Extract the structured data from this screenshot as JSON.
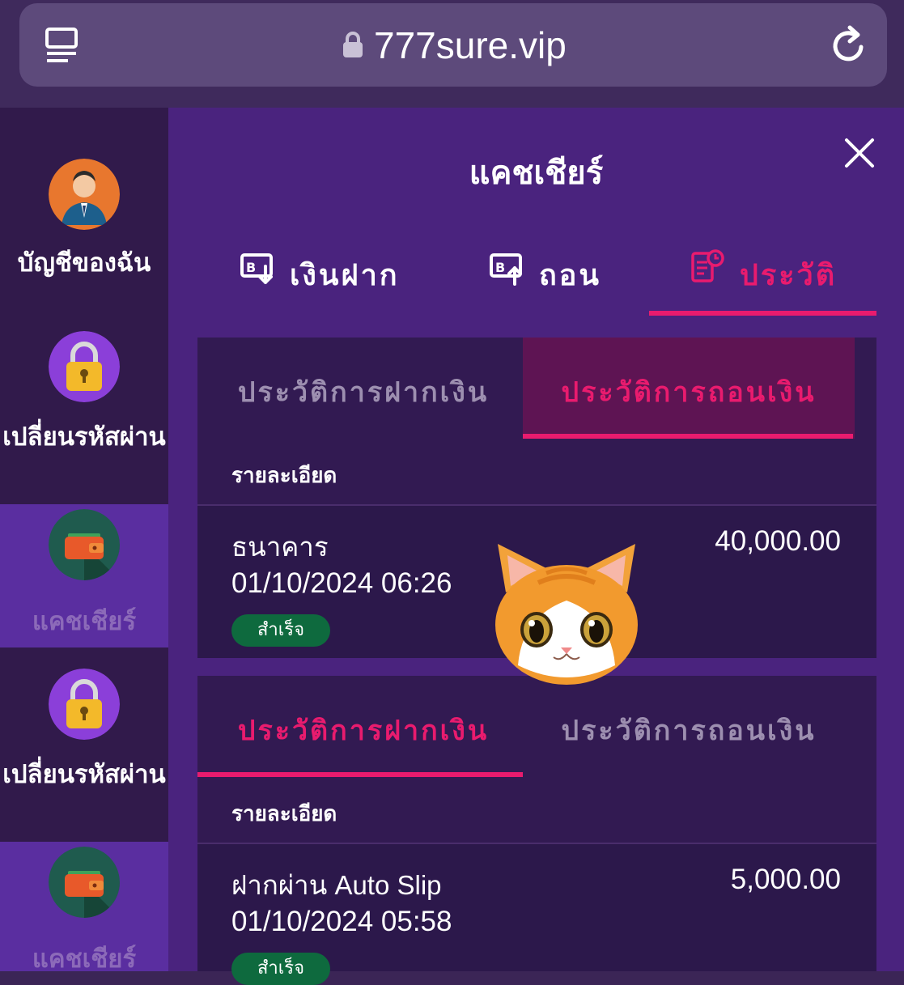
{
  "browser": {
    "url": "777sure.vip"
  },
  "sidebar": {
    "items": [
      {
        "label": "บัญชีของฉัน"
      },
      {
        "label": "เปลี่ยนรหัสผ่าน"
      },
      {
        "label": "แคชเชียร์"
      },
      {
        "label": "เปลี่ยนรหัสผ่าน"
      },
      {
        "label": "แคชเชียร์"
      }
    ]
  },
  "main": {
    "title": "แคชเชียร์",
    "tabs": [
      {
        "label": "เงินฝาก"
      },
      {
        "label": "ถอน"
      },
      {
        "label": "ประวัติ"
      }
    ],
    "history_cards": [
      {
        "subtabs": [
          "ประวัติการฝากเงิน",
          "ประวัติการถอนเงิน"
        ],
        "active_subtab": 1,
        "detail_header": "รายละเอียด",
        "row": {
          "title": "ธนาคาร",
          "date": "01/10/2024 06:26",
          "amount": "40,000.00",
          "status": "สำเร็จ"
        }
      },
      {
        "subtabs": [
          "ประวัติการฝากเงิน",
          "ประวัติการถอนเงิน"
        ],
        "active_subtab": 0,
        "detail_header": "รายละเอียด",
        "row": {
          "title": "ฝากผ่าน Auto Slip",
          "date": "01/10/2024 05:58",
          "amount": "5,000.00",
          "status": "สำเร็จ"
        }
      }
    ]
  },
  "colors": {
    "accent": "#e91b6e",
    "panel": "#4a237e",
    "sidebar": "#311a4b",
    "success": "#0e6a3e"
  }
}
